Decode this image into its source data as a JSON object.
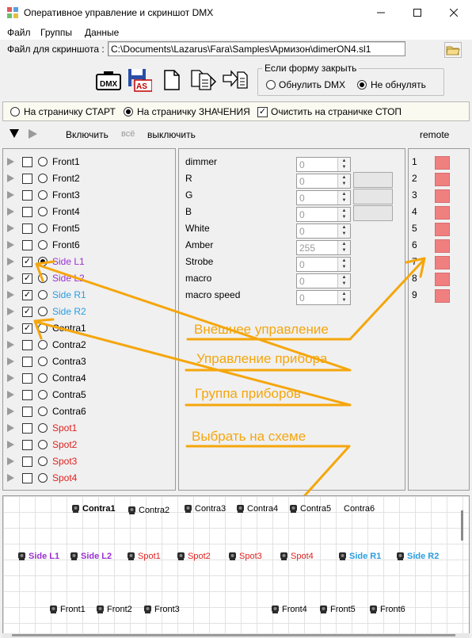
{
  "window": {
    "title": "Оперативное управление и скриншот DMX",
    "minimize_icon": "minimize-icon",
    "maximize_icon": "maximize-icon",
    "close_icon": "close-icon"
  },
  "menu": [
    "Файл",
    "Группы",
    "Данные"
  ],
  "screenshot_file": {
    "label": "Файл для скриншота :",
    "value": "C:\\Documents\\Lazarus\\Fara\\Samples\\Армизон\\dimerON4.sl1"
  },
  "toolbar_icons": [
    "dmx-camera-icon",
    "save-as-icon",
    "new-file-icon",
    "copy-files-icon",
    "export-icon"
  ],
  "close_form": {
    "legend": "Если форму закрыть",
    "options": [
      "Обнулить DMX",
      "Не обнулять"
    ],
    "selected": "Не обнулять"
  },
  "pages": {
    "option_start": "На страничку СТАРТ",
    "option_values": "На страничку ЗНАЧЕНИЯ",
    "selected": "На страничку ЗНАЧЕНИЯ",
    "clear_stop_label": "Очистить на страничке СТОП",
    "clear_stop_checked": true
  },
  "controls": {
    "enable": "Включить",
    "all": "всё",
    "disable": "выключить",
    "remote": "remote"
  },
  "fixtures": [
    {
      "name": "Front1",
      "checked": false,
      "selected": false,
      "color": "#000000"
    },
    {
      "name": "Front2",
      "checked": false,
      "selected": false,
      "color": "#000000"
    },
    {
      "name": "Front3",
      "checked": false,
      "selected": false,
      "color": "#000000"
    },
    {
      "name": "Front4",
      "checked": false,
      "selected": false,
      "color": "#000000"
    },
    {
      "name": "Front5",
      "checked": false,
      "selected": false,
      "color": "#000000"
    },
    {
      "name": "Front6",
      "checked": false,
      "selected": false,
      "color": "#000000"
    },
    {
      "name": "Side L1",
      "checked": true,
      "selected": true,
      "color": "#9b30d0"
    },
    {
      "name": "Side L2",
      "checked": true,
      "selected": false,
      "color": "#9b30d0"
    },
    {
      "name": "Side R1",
      "checked": true,
      "selected": false,
      "color": "#2a9de0"
    },
    {
      "name": "Side R2",
      "checked": true,
      "selected": false,
      "color": "#2a9de0"
    },
    {
      "name": "Contra1",
      "checked": true,
      "selected": false,
      "color": "#000000"
    },
    {
      "name": "Contra2",
      "checked": false,
      "selected": false,
      "color": "#000000"
    },
    {
      "name": "Contra3",
      "checked": false,
      "selected": false,
      "color": "#000000"
    },
    {
      "name": "Contra4",
      "checked": false,
      "selected": false,
      "color": "#000000"
    },
    {
      "name": "Contra5",
      "checked": false,
      "selected": false,
      "color": "#000000"
    },
    {
      "name": "Contra6",
      "checked": false,
      "selected": false,
      "color": "#000000"
    },
    {
      "name": "Spot1",
      "checked": false,
      "selected": false,
      "color": "#e02020"
    },
    {
      "name": "Spot2",
      "checked": false,
      "selected": false,
      "color": "#e02020"
    },
    {
      "name": "Spot3",
      "checked": false,
      "selected": false,
      "color": "#e02020"
    },
    {
      "name": "Spot4",
      "checked": false,
      "selected": false,
      "color": "#e02020"
    }
  ],
  "channels": [
    {
      "name": "dimmer",
      "value": "0"
    },
    {
      "name": "R",
      "value": "0"
    },
    {
      "name": "G",
      "value": "0"
    },
    {
      "name": "B",
      "value": "0"
    },
    {
      "name": "White",
      "value": "0"
    },
    {
      "name": "Amber",
      "value": "255"
    },
    {
      "name": "Strobe",
      "value": "0"
    },
    {
      "name": "macro",
      "value": "0"
    },
    {
      "name": "macro speed",
      "value": "0"
    }
  ],
  "remote": [
    "1",
    "2",
    "3",
    "4",
    "5",
    "6",
    "7",
    "8",
    "9"
  ],
  "annotations": {
    "external": "Внешнее управление",
    "device": "Управление прибора",
    "group": "Группа приборов",
    "choose": "Выбрать на схеме",
    "color": "#f5a60c"
  },
  "plan": {
    "row1": [
      {
        "name": "Contra1",
        "color": "#000000",
        "bold": true
      },
      {
        "name": "Contra2",
        "color": "#000000",
        "bold": false
      },
      {
        "name": "Contra3",
        "color": "#000000",
        "bold": false
      },
      {
        "name": "Contra4",
        "color": "#000000",
        "bold": false
      },
      {
        "name": "Contra5",
        "color": "#000000",
        "bold": false
      },
      {
        "name": "Contra6",
        "color": "#000000",
        "bold": false
      }
    ],
    "row2": [
      {
        "name": "Side L1",
        "color": "#9b30d0",
        "bold": true
      },
      {
        "name": "Side L2",
        "color": "#9b30d0",
        "bold": true
      },
      {
        "name": "Spot1",
        "color": "#e02020",
        "bold": false
      },
      {
        "name": "Spot2",
        "color": "#e02020",
        "bold": false
      },
      {
        "name": "Spot3",
        "color": "#e02020",
        "bold": false
      },
      {
        "name": "Spot4",
        "color": "#e02020",
        "bold": false
      },
      {
        "name": "Side R1",
        "color": "#2a9de0",
        "bold": true
      },
      {
        "name": "Side R2",
        "color": "#2a9de0",
        "bold": true
      }
    ],
    "row3": [
      {
        "name": "Front1",
        "color": "#000000",
        "bold": false
      },
      {
        "name": "Front2",
        "color": "#000000",
        "bold": false
      },
      {
        "name": "Front3",
        "color": "#000000",
        "bold": false
      },
      {
        "name": "Front4",
        "color": "#000000",
        "bold": false
      },
      {
        "name": "Front5",
        "color": "#000000",
        "bold": false
      },
      {
        "name": "Front6",
        "color": "#000000",
        "bold": false
      }
    ]
  }
}
